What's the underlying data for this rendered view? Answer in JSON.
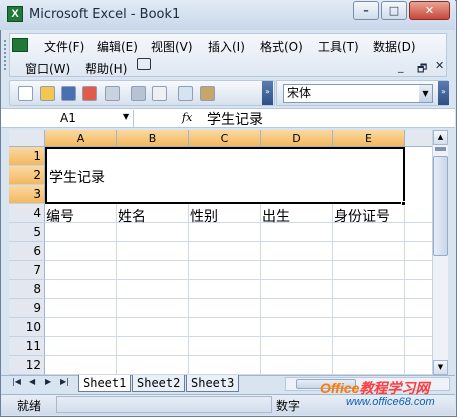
{
  "window": {
    "title": "Microsoft Excel - Book1",
    "app_icon_glyph": "X"
  },
  "window_controls": {
    "minimize": "–",
    "maximize": "□",
    "close": "✕"
  },
  "menu": {
    "items": [
      "文件(F)",
      "编辑(E)",
      "视图(V)",
      "插入(I)",
      "格式(O)",
      "工具(T)",
      "数据(D)",
      "窗口(W)",
      "帮助(H)"
    ]
  },
  "doc_controls": {
    "minimize": "_",
    "restore": "🗗",
    "close": "✕"
  },
  "toolbar": {
    "font_name": "宋体"
  },
  "formula_bar": {
    "name_box": "A1",
    "fx_label": "fx",
    "formula": "学生记录"
  },
  "sheet": {
    "columns": [
      "A",
      "B",
      "C",
      "D",
      "E"
    ],
    "rows": [
      "1",
      "2",
      "3",
      "4",
      "5",
      "6",
      "7",
      "8",
      "9",
      "10",
      "11",
      "12"
    ],
    "merged_title": "学生记录",
    "row4": [
      "编号",
      "姓名",
      "性别",
      "出生",
      "身份证号"
    ]
  },
  "tabs": {
    "items": [
      "Sheet1",
      "Sheet2",
      "Sheet3"
    ]
  },
  "status": {
    "ready": "就绪",
    "mode": "数字"
  },
  "watermark": {
    "brand": "Office",
    "cn": "教程学习网",
    "url": "www.office68.com"
  },
  "colors": {
    "accent_header": "#f3b860",
    "title_gradient_top": "#e2ebf6",
    "close_red": "#c7473a"
  }
}
